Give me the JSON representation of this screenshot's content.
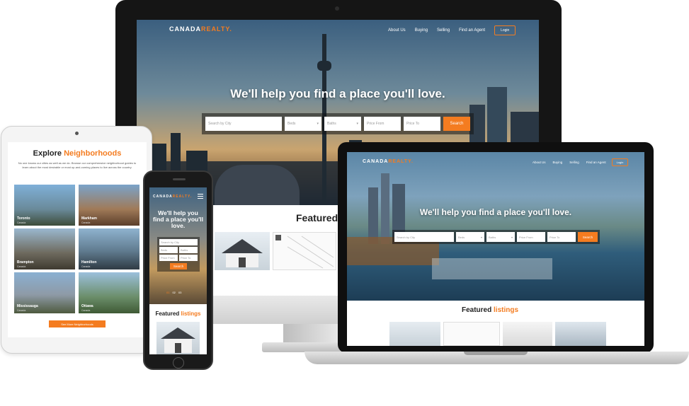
{
  "brand": {
    "name_white": "CANADA",
    "name_orange": "REALTY.",
    "accent": "#f47c20"
  },
  "nav": {
    "about": "About Us",
    "buying": "Buying",
    "selling": "Selling",
    "agent": "Find an Agent",
    "login": "Login"
  },
  "hero": {
    "title": "We'll help you find a place you'll love."
  },
  "search": {
    "city": "Search by City",
    "beds": "Beds",
    "baths": "Baths",
    "price_from": "Price From",
    "price_to": "Price To",
    "button": "Search"
  },
  "featured": {
    "word": "Featured",
    "accent_word": "listings"
  },
  "tablet": {
    "title_plain": "Explore",
    "title_accent": "Neighborhoods",
    "intro": "No one knows our cities as well as we do. Browse our comprehensive neighborhood guides to learn about the most desirable or most up-and-coming places to live across the country.",
    "tiles": [
      {
        "name": "Toronto",
        "country": "Canada"
      },
      {
        "name": "Markham",
        "country": "Canada"
      },
      {
        "name": "Brampton",
        "country": "Canada"
      },
      {
        "name": "Hamilton",
        "country": "Canada"
      },
      {
        "name": "Mississauga",
        "country": "Canada"
      },
      {
        "name": "Ottawa",
        "country": "Canada"
      }
    ],
    "more_button": "See More Neighborhoods"
  },
  "phone": {
    "title": "We'll help you find a place you'll love.",
    "city": "Search by City",
    "beds": "Beds",
    "baths": "Baths",
    "price_from": "Price From",
    "price_to": "Price To",
    "button": "Search",
    "pager": [
      "01",
      "02",
      "03"
    ],
    "featured_word": "Featured",
    "featured_accent": "listings"
  }
}
